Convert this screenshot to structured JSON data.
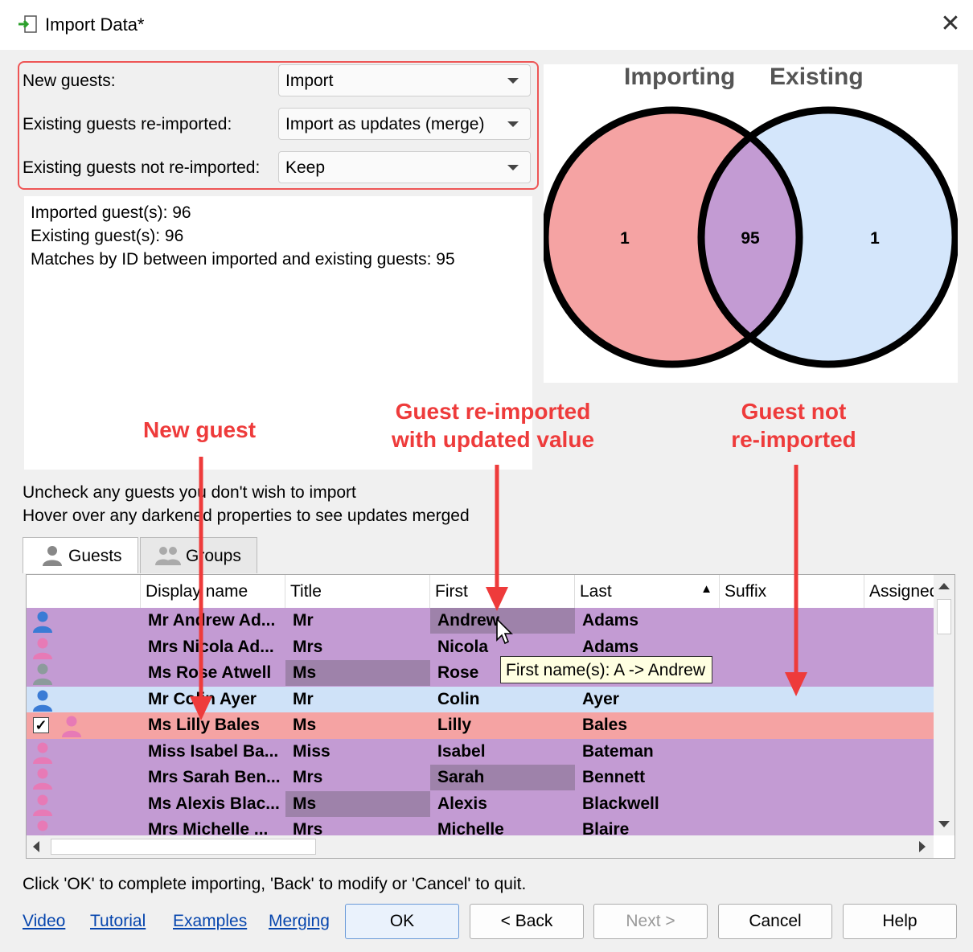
{
  "window": {
    "title": "Import Data*"
  },
  "options": [
    {
      "label": "New guests:",
      "value": "Import"
    },
    {
      "label": "Existing guests re-imported:",
      "value": "Import as updates (merge)"
    },
    {
      "label": "Existing guests not re-imported:",
      "value": "Keep"
    }
  ],
  "info": {
    "lines": [
      "Imported guest(s): 96",
      "Existing guest(s): 96",
      "Matches by ID between imported and existing guests: 95"
    ]
  },
  "venn": {
    "left_label": "Importing",
    "right_label": "Existing",
    "left_only": "1",
    "overlap": "95",
    "right_only": "1",
    "colors": {
      "left": "#f5a3a3",
      "right": "#d4e6fb",
      "overlap": "#c39bd3"
    }
  },
  "annotations": {
    "new_guest": "New guest",
    "reimported_line1": "Guest re-imported",
    "reimported_line2": "with updated value",
    "not_reimported_line1": "Guest not",
    "not_reimported_line2": "re-imported",
    "color": "#ee3b3b"
  },
  "instructions": [
    "Uncheck any guests you don't wish to import",
    "Hover over any darkened properties to see updates merged"
  ],
  "tabs": [
    {
      "label": "Guests",
      "icon": "person-icon",
      "active": true
    },
    {
      "label": "Groups",
      "icon": "people-icon",
      "active": false
    }
  ],
  "grid": {
    "columns": [
      "",
      "Display name",
      "Title",
      "First",
      "Last",
      "Suffix",
      "Assigned"
    ],
    "sort_indicator": "▲",
    "rows": [
      {
        "icon": "male-icon",
        "checked": false,
        "status": "merged",
        "display": "Mr Andrew Ad...",
        "title": "Mr",
        "first": "Andrew",
        "last": "Adams",
        "updated": [
          "first"
        ]
      },
      {
        "icon": "female-icon",
        "checked": false,
        "status": "merged",
        "display": "Mrs Nicola Ad...",
        "title": "Mrs",
        "first": "Nicola",
        "last": "Adams",
        "updated": []
      },
      {
        "icon": "neutral-icon",
        "checked": false,
        "status": "merged",
        "display": "Ms Rose Atwell",
        "title": "Ms",
        "first": "Rose",
        "last": "",
        "updated": [
          "title"
        ]
      },
      {
        "icon": "male-icon",
        "checked": false,
        "status": "not-reimported",
        "display": "Mr Colin Ayer",
        "title": "Mr",
        "first": "Colin",
        "last": "Ayer",
        "updated": []
      },
      {
        "icon": "female-icon",
        "checked": true,
        "status": "new",
        "display": "Ms Lilly Bales",
        "title": "Ms",
        "first": "Lilly",
        "last": "Bales",
        "updated": []
      },
      {
        "icon": "female-icon",
        "checked": false,
        "status": "merged",
        "display": "Miss Isabel Ba...",
        "title": "Miss",
        "first": "Isabel",
        "last": "Bateman",
        "updated": []
      },
      {
        "icon": "female-icon",
        "checked": false,
        "status": "merged",
        "display": "Mrs Sarah Ben...",
        "title": "Mrs",
        "first": "Sarah",
        "last": "Bennett",
        "updated": [
          "first"
        ]
      },
      {
        "icon": "female-icon",
        "checked": false,
        "status": "merged",
        "display": "Ms Alexis Blac...",
        "title": "Ms",
        "first": "Alexis",
        "last": "Blackwell",
        "updated": [
          "title"
        ]
      },
      {
        "icon": "female-icon",
        "checked": false,
        "status": "merged",
        "display": "Mrs Michelle ...",
        "title": "Mrs",
        "first": "Michelle",
        "last": "Blaire",
        "updated": []
      }
    ],
    "status_colors": {
      "merged": "#c39bd3",
      "new": "#f5a3a3",
      "not-reimported": "#cfe2f8",
      "updated_cell": "#9e82aa"
    },
    "icon_colors": {
      "male-icon": "#3a7bd5",
      "female-icon": "#e77ab6",
      "neutral-icon": "#8c9b9c"
    }
  },
  "tooltip": {
    "text": "First name(s): A -> Andrew"
  },
  "footer": {
    "text": "Click 'OK' to complete importing, 'Back' to modify or 'Cancel' to quit.",
    "links": [
      "Video",
      "Tutorial",
      "Examples",
      "Merging"
    ],
    "buttons": {
      "ok": "OK",
      "back": "< Back",
      "next": "Next >",
      "cancel": "Cancel",
      "help": "Help"
    }
  }
}
